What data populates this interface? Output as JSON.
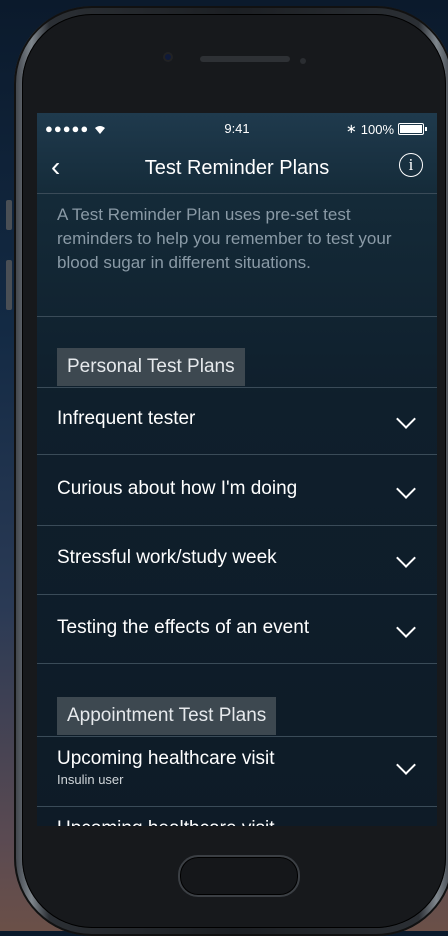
{
  "status_bar": {
    "signal": "●●●●● ",
    "wifi_icon": "wifi-icon",
    "time": "9:41",
    "bluetooth": "∗",
    "battery": "100%"
  },
  "nav": {
    "back": "‹",
    "title": "Test Reminder Plans",
    "info": "i"
  },
  "intro": "A Test Reminder Plan uses pre-set test reminders to help you remember to test your blood sugar in different situations.",
  "sections": [
    {
      "title": "Personal Test Plans",
      "items": [
        {
          "label": "Infrequent tester",
          "sub": ""
        },
        {
          "label": "Curious about how I'm doing",
          "sub": ""
        },
        {
          "label": "Stressful work/study week",
          "sub": ""
        },
        {
          "label": "Testing the effects of an event",
          "sub": ""
        }
      ]
    },
    {
      "title": "Appointment Test Plans",
      "items": [
        {
          "label": "Upcoming healthcare visit",
          "sub": "Insulin user"
        },
        {
          "label": "Upcoming healthcare visit",
          "sub": ""
        }
      ]
    }
  ]
}
